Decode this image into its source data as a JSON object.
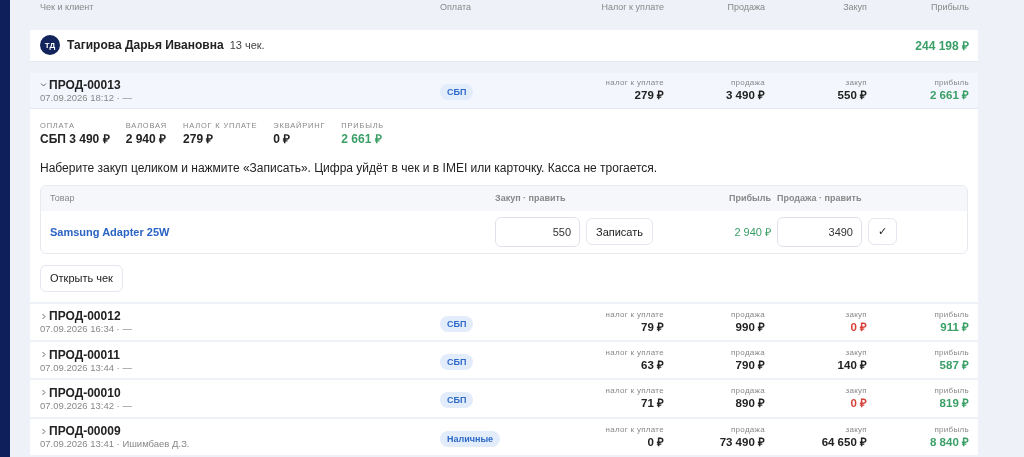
{
  "table": {
    "columns": [
      "Чек и клиент",
      "Оплата",
      "Налог к уплате",
      "Продажа",
      "Закуп",
      "Прибыль"
    ]
  },
  "client": {
    "initials": "ТД",
    "name": "Тагирова Дарья Ивановна",
    "count": "13 чек.",
    "profit": "244 198 ₽"
  },
  "receipts": [
    {
      "number": "ПРОД-00013",
      "meta": "07.09.2026 18:12 · —",
      "payment": "СБП",
      "expanded": true,
      "tax_label": "налог к уплате",
      "tax": "279 ₽",
      "sale_label": "продажа",
      "sale": "3 490 ₽",
      "cost_label": "закуп",
      "cost": "550 ₽",
      "cost_missing": false,
      "profit_label": "прибыль",
      "profit": "2 661 ₽",
      "details": {
        "metrics": [
          {
            "label": "ОПЛАТА",
            "value": "СБП 3 490 ₽",
            "kind": "amount"
          },
          {
            "label": "ВАЛОВАЯ",
            "value": "2 940 ₽",
            "kind": "amount"
          },
          {
            "label": "НАЛОГ К УПЛАТЕ",
            "value": "279 ₽",
            "kind": "amount"
          },
          {
            "label": "ЭКВАЙРИНГ",
            "value": "0 ₽",
            "kind": "amount"
          },
          {
            "label": "ПРИБЫЛЬ",
            "value": "2 661 ₽",
            "kind": "profit"
          }
        ],
        "hint": "Наберите закуп целиком и нажмите «Записать». Цифра уйдёт в чек и в IMEI или карточку. Касса не трогается.",
        "items": {
          "columns": [
            "Товар",
            "Закуп · править",
            "Прибыль",
            "Продажа · править"
          ],
          "rows": [
            {
              "name": "Samsung Adapter 25W",
              "cost": "550",
              "save_button": "Записать",
              "profit": "2 940 ₽",
              "sale": "3490",
              "confirm_button": "✓"
            }
          ]
        },
        "open_button": "Открыть чек"
      }
    },
    {
      "number": "ПРОД-00012",
      "meta": "07.09.2026 16:34 · —",
      "payment": "СБП",
      "expanded": false,
      "tax_label": "налог к уплате",
      "tax": "79 ₽",
      "sale_label": "продажа",
      "sale": "990 ₽",
      "cost_label": "закуп",
      "cost": "0 ₽",
      "cost_missing": true,
      "profit_label": "прибыль",
      "profit": "911 ₽"
    },
    {
      "number": "ПРОД-00011",
      "meta": "07.09.2026 13:44 · —",
      "payment": "СБП",
      "expanded": false,
      "tax_label": "налог к уплате",
      "tax": "63 ₽",
      "sale_label": "продажа",
      "sale": "790 ₽",
      "cost_label": "закуп",
      "cost": "140 ₽",
      "cost_missing": false,
      "profit_label": "прибыль",
      "profit": "587 ₽"
    },
    {
      "number": "ПРОД-00010",
      "meta": "07.09.2026 13:42 · —",
      "payment": "СБП",
      "expanded": false,
      "tax_label": "налог к уплате",
      "tax": "71 ₽",
      "sale_label": "продажа",
      "sale": "890 ₽",
      "cost_label": "закуп",
      "cost": "0 ₽",
      "cost_missing": true,
      "profit_label": "прибыль",
      "profit": "819 ₽"
    },
    {
      "number": "ПРОД-00009",
      "meta": "07.09.2026 13:41 · Ишимбаев Д.З.",
      "payment": "Наличные",
      "expanded": false,
      "tax_label": "налог к уплате",
      "tax": "0 ₽",
      "sale_label": "продажа",
      "sale": "73 490 ₽",
      "cost_label": "закуп",
      "cost": "64 650 ₽",
      "cost_missing": false,
      "profit_label": "прибыль",
      "profit": "8 840 ₽"
    }
  ]
}
